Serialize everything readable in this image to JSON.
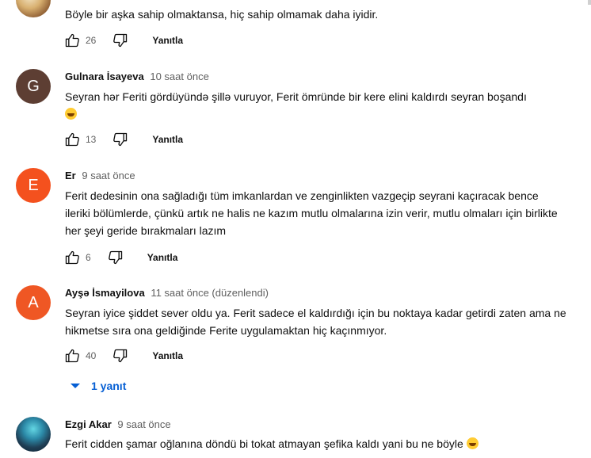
{
  "comments": [
    {
      "id": "c0",
      "author": "",
      "time": "",
      "text": "Böyle bir aşka sahip olmaktansa, hiç sahip olmamak daha iyidir.",
      "likes": "26",
      "reply_label": "Yanıtla",
      "avatar": {
        "type": "image-icon",
        "initial": ""
      }
    },
    {
      "id": "c1",
      "author": "Gulnara İsayeva",
      "time": "10 saat önce",
      "text": "Seyran hər Feriti gördüyündə şillə vuruyor, Ferit ömründe bir kere elini kaldırdı seyran boşandı",
      "likes": "13",
      "reply_label": "Yanıtla",
      "avatar": {
        "type": "letter",
        "initial": "G",
        "color": "#5d3e33"
      }
    },
    {
      "id": "c2",
      "author": "Er",
      "time": "9 saat önce",
      "text": "Ferit dedesinin ona sağladığı tüm imkanlardan ve zenginlikten vazgeçip seyrani kaçıracak bence ileriki bölümlerde, çünkü artık ne halis ne kazım mutlu olmalarına izin verir, mutlu olmaları için birlikte her şeyi geride bırakmaları lazım",
      "likes": "6",
      "reply_label": "Yanıtla",
      "avatar": {
        "type": "letter",
        "initial": "E",
        "color": "#f4511e"
      }
    },
    {
      "id": "c3",
      "author": "Ayşə İsmayilova",
      "time": "11 saat önce (düzenlendi)",
      "text": "Seyran iyice şiddet sever oldu ya. Ferit sadece el kaldırdığı için bu noktaya kadar getirdi zaten ama ne hikmetse sıra ona geldiğinde Ferite uygulamaktan hiç kaçınmıyor.",
      "likes": "40",
      "reply_label": "Yanıtla",
      "replies_toggle": "1 yanıt",
      "avatar": {
        "type": "letter",
        "initial": "A",
        "color": "#ef5724"
      }
    },
    {
      "id": "c4",
      "author": "Ezgi Akar",
      "time": "9 saat önce",
      "text": "Ferit cidden şamar oğlanına döndü bi tokat atmayan şefika kaldı yani bu ne böyle",
      "avatar": {
        "type": "image-icon",
        "initial": ""
      }
    }
  ],
  "icons": {
    "like": "thumb-up-icon",
    "dislike": "thumb-down-icon",
    "expand": "chevron-down-icon",
    "emoji": "grinning-face-with-sweat-icon"
  },
  "colors": {
    "link_blue": "#065fd4",
    "meta_gray": "#606060"
  }
}
